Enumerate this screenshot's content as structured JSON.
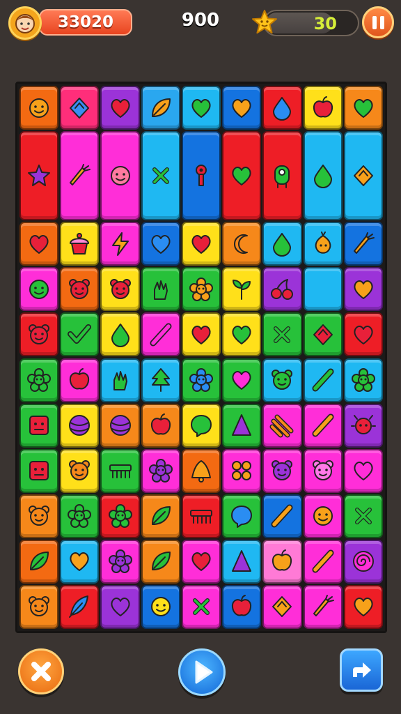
{
  "hud": {
    "coins": "33020",
    "score": "900",
    "stars": "30",
    "avatar_icon": "avatar-face-icon",
    "star_icon": "star-icon",
    "pause_icon": "pause-icon"
  },
  "board": {
    "rows": 12,
    "cols": 9,
    "tiles": [
      {
        "r": 0,
        "c": 0,
        "color": "#f36a12",
        "icon": "smiley",
        "ic": "#f7a11a"
      },
      {
        "r": 0,
        "c": 1,
        "color": "#ff2e7a",
        "icon": "diamond",
        "ic": "#3a8df2"
      },
      {
        "r": 0,
        "c": 2,
        "color": "#9b33d8",
        "icon": "heart",
        "ic": "#e8203a"
      },
      {
        "r": 0,
        "c": 3,
        "color": "#2aa7ef",
        "icon": "leaf",
        "ic": "#f7a11a"
      },
      {
        "r": 0,
        "c": 4,
        "color": "#1fb8f2",
        "icon": "heart",
        "ic": "#27c13a"
      },
      {
        "r": 0,
        "c": 5,
        "color": "#1473e0",
        "icon": "heart",
        "ic": "#f7a11a"
      },
      {
        "r": 0,
        "c": 6,
        "color": "#ee1e26",
        "icon": "drop",
        "ic": "#2a8df2"
      },
      {
        "r": 0,
        "c": 7,
        "color": "#ffe01a",
        "icon": "apple",
        "ic": "#e8203a"
      },
      {
        "r": 0,
        "c": 8,
        "color": "#f6881a",
        "icon": "heart",
        "ic": "#27c13a"
      },
      {
        "r": 1,
        "c": 0,
        "color": "#ee1e26",
        "h": 2,
        "icon": "star",
        "ic": "#9b33d8"
      },
      {
        "r": 1,
        "c": 1,
        "color": "#ff2ed8",
        "h": 2,
        "icon": "carrot",
        "ic": "#f7a11a"
      },
      {
        "r": 1,
        "c": 2,
        "color": "#ff2ed8",
        "h": 2,
        "icon": "smiley",
        "ic": "#ff7aa0"
      },
      {
        "r": 1,
        "c": 3,
        "color": "#1fb8f2",
        "h": 2,
        "icon": "cross",
        "ic": "#27c13a"
      },
      {
        "r": 1,
        "c": 4,
        "color": "#1473e0",
        "h": 2,
        "icon": "key",
        "ic": "#e8203a"
      },
      {
        "r": 1,
        "c": 5,
        "color": "#ee1e26",
        "h": 2,
        "icon": "heart",
        "ic": "#27c13a"
      },
      {
        "r": 1,
        "c": 6,
        "color": "#ee1e26",
        "h": 2,
        "icon": "robot",
        "ic": "#27c13a"
      },
      {
        "r": 1,
        "c": 7,
        "color": "#1fb8f2",
        "h": 2,
        "icon": "drop",
        "ic": "#27c13a"
      },
      {
        "r": 1,
        "c": 8,
        "color": "#1fb8f2",
        "h": 2,
        "icon": "diamond",
        "ic": "#f7a11a"
      },
      {
        "r": 3,
        "c": 0,
        "color": "#f36a12",
        "icon": "heart",
        "ic": "#e8203a"
      },
      {
        "r": 3,
        "c": 1,
        "color": "#ffe01a",
        "icon": "cupcake",
        "ic": "#e8203a"
      },
      {
        "r": 3,
        "c": 2,
        "color": "#ff2ed8",
        "icon": "bolt",
        "ic": "#f7a11a"
      },
      {
        "r": 3,
        "c": 3,
        "color": "#1473e0",
        "icon": "heart",
        "ic": "#2a8df2"
      },
      {
        "r": 3,
        "c": 4,
        "color": "#ffe01a",
        "icon": "heart",
        "ic": "#e8203a"
      },
      {
        "r": 3,
        "c": 5,
        "color": "#f6881a",
        "icon": "moon",
        "ic": "#f6881a"
      },
      {
        "r": 3,
        "c": 6,
        "color": "#1fb8f2",
        "icon": "drop",
        "ic": "#27c13a"
      },
      {
        "r": 3,
        "c": 7,
        "color": "#1fb8f2",
        "icon": "onion",
        "ic": "#f7a11a"
      },
      {
        "r": 3,
        "c": 8,
        "color": "#1473e0",
        "icon": "carrot",
        "ic": "#f7a11a"
      },
      {
        "r": 4,
        "c": 0,
        "color": "#ff2ed8",
        "icon": "smiley",
        "ic": "#27c13a"
      },
      {
        "r": 4,
        "c": 1,
        "color": "#f36a12",
        "icon": "bear",
        "ic": "#e8203a"
      },
      {
        "r": 4,
        "c": 2,
        "color": "#ffe01a",
        "icon": "bear",
        "ic": "#e8203a"
      },
      {
        "r": 4,
        "c": 3,
        "color": "#27c13a",
        "icon": "hand",
        "ic": "#27c13a"
      },
      {
        "r": 4,
        "c": 4,
        "color": "#27c13a",
        "icon": "flower",
        "ic": "#f7a11a"
      },
      {
        "r": 4,
        "c": 5,
        "color": "#ffe01a",
        "icon": "sprout",
        "ic": "#27c13a"
      },
      {
        "r": 4,
        "c": 6,
        "color": "#9b33d8",
        "icon": "cherry",
        "ic": "#e8203a"
      },
      {
        "r": 4,
        "c": 7,
        "color": "#1fb8f2",
        "icon": "none",
        "ic": "#1fb8f2"
      },
      {
        "r": 4,
        "c": 8,
        "color": "#9b33d8",
        "icon": "heart",
        "ic": "#f7a11a"
      },
      {
        "r": 5,
        "c": 0,
        "color": "#ee1e26",
        "icon": "bear",
        "ic": "#e8203a"
      },
      {
        "r": 5,
        "c": 1,
        "color": "#27c13a",
        "icon": "check",
        "ic": "#27c13a"
      },
      {
        "r": 5,
        "c": 2,
        "color": "#ffe01a",
        "icon": "drop",
        "ic": "#27c13a"
      },
      {
        "r": 5,
        "c": 3,
        "color": "#ff2ed8",
        "icon": "slash",
        "ic": "#ff2ed8"
      },
      {
        "r": 5,
        "c": 4,
        "color": "#ffe01a",
        "icon": "heart",
        "ic": "#e8203a"
      },
      {
        "r": 5,
        "c": 5,
        "color": "#ffe01a",
        "icon": "heart",
        "ic": "#27c13a"
      },
      {
        "r": 5,
        "c": 6,
        "color": "#27c13a",
        "icon": "cross",
        "ic": "#27c13a"
      },
      {
        "r": 5,
        "c": 7,
        "color": "#27c13a",
        "icon": "diamond",
        "ic": "#e8203a"
      },
      {
        "r": 5,
        "c": 8,
        "color": "#ee1e26",
        "icon": "heart",
        "ic": "#e8203a"
      },
      {
        "r": 6,
        "c": 0,
        "color": "#27c13a",
        "icon": "flower",
        "ic": "#27c13a"
      },
      {
        "r": 6,
        "c": 1,
        "color": "#ff2ed8",
        "icon": "apple",
        "ic": "#e8203a"
      },
      {
        "r": 6,
        "c": 2,
        "color": "#1fb8f2",
        "icon": "hand",
        "ic": "#27c13a"
      },
      {
        "r": 6,
        "c": 3,
        "color": "#1fb8f2",
        "icon": "tree",
        "ic": "#27c13a"
      },
      {
        "r": 6,
        "c": 4,
        "color": "#27c13a",
        "icon": "flower",
        "ic": "#2a8df2"
      },
      {
        "r": 6,
        "c": 5,
        "color": "#27c13a",
        "icon": "heart",
        "ic": "#ff2ed8"
      },
      {
        "r": 6,
        "c": 6,
        "color": "#1fb8f2",
        "icon": "bear",
        "ic": "#27c13a"
      },
      {
        "r": 6,
        "c": 7,
        "color": "#1fb8f2",
        "icon": "slash",
        "ic": "#27c13a"
      },
      {
        "r": 6,
        "c": 8,
        "color": "#1fb8f2",
        "icon": "flower",
        "ic": "#27c13a"
      },
      {
        "r": 7,
        "c": 0,
        "color": "#27c13a",
        "icon": "box",
        "ic": "#e8203a"
      },
      {
        "r": 7,
        "c": 1,
        "color": "#ffe01a",
        "icon": "ball",
        "ic": "#9b33d8"
      },
      {
        "r": 7,
        "c": 2,
        "color": "#f6881a",
        "icon": "ball",
        "ic": "#9b33d8"
      },
      {
        "r": 7,
        "c": 3,
        "color": "#f6881a",
        "icon": "apple",
        "ic": "#e8203a"
      },
      {
        "r": 7,
        "c": 4,
        "color": "#ffe01a",
        "icon": "bubble",
        "ic": "#27c13a"
      },
      {
        "r": 7,
        "c": 5,
        "color": "#27c13a",
        "icon": "cone",
        "ic": "#9b33d8"
      },
      {
        "r": 7,
        "c": 6,
        "color": "#ff2ed8",
        "icon": "stripes",
        "ic": "#f6881a"
      },
      {
        "r": 7,
        "c": 7,
        "color": "#ff2ed8",
        "icon": "slash",
        "ic": "#f7a11a"
      },
      {
        "r": 7,
        "c": 8,
        "color": "#9b33d8",
        "icon": "bug",
        "ic": "#e8203a"
      },
      {
        "r": 8,
        "c": 0,
        "color": "#27c13a",
        "icon": "box",
        "ic": "#e8203a"
      },
      {
        "r": 8,
        "c": 1,
        "color": "#ffe01a",
        "icon": "bear",
        "ic": "#f6881a"
      },
      {
        "r": 8,
        "c": 2,
        "color": "#27c13a",
        "icon": "comb",
        "ic": "#27c13a"
      },
      {
        "r": 8,
        "c": 3,
        "color": "#ff2ed8",
        "icon": "flower",
        "ic": "#9b33d8"
      },
      {
        "r": 8,
        "c": 4,
        "color": "#f36a12",
        "icon": "bell",
        "ic": "#f7a11a"
      },
      {
        "r": 8,
        "c": 5,
        "color": "#ff2ed8",
        "icon": "dots",
        "ic": "#f7a11a"
      },
      {
        "r": 8,
        "c": 6,
        "color": "#ff2ed8",
        "icon": "bear",
        "ic": "#9b33d8"
      },
      {
        "r": 8,
        "c": 7,
        "color": "#ff2ed8",
        "icon": "bear",
        "ic": "#ff7ae8"
      },
      {
        "r": 8,
        "c": 8,
        "color": "#ff2ed8",
        "icon": "heart",
        "ic": "#ff2ed8"
      },
      {
        "r": 9,
        "c": 0,
        "color": "#f6881a",
        "icon": "bear",
        "ic": "#f6881a"
      },
      {
        "r": 9,
        "c": 1,
        "color": "#27c13a",
        "icon": "flower",
        "ic": "#27c13a"
      },
      {
        "r": 9,
        "c": 2,
        "color": "#ee1e26",
        "icon": "flower",
        "ic": "#27c13a"
      },
      {
        "r": 9,
        "c": 3,
        "color": "#f6881a",
        "icon": "leaf",
        "ic": "#27c13a"
      },
      {
        "r": 9,
        "c": 4,
        "color": "#ee1e26",
        "icon": "comb",
        "ic": "#ee1e26"
      },
      {
        "r": 9,
        "c": 5,
        "color": "#27c13a",
        "icon": "bubble",
        "ic": "#2a8df2"
      },
      {
        "r": 9,
        "c": 6,
        "color": "#1473e0",
        "icon": "slash",
        "ic": "#f7a11a"
      },
      {
        "r": 9,
        "c": 7,
        "color": "#ff2ed8",
        "icon": "smiley",
        "ic": "#f7a11a"
      },
      {
        "r": 9,
        "c": 8,
        "color": "#27c13a",
        "icon": "cross",
        "ic": "#27c13a"
      },
      {
        "r": 10,
        "c": 0,
        "color": "#f36a12",
        "icon": "leaf",
        "ic": "#27c13a"
      },
      {
        "r": 10,
        "c": 1,
        "color": "#1fb8f2",
        "icon": "heart",
        "ic": "#f7a11a"
      },
      {
        "r": 10,
        "c": 2,
        "color": "#ff2ed8",
        "icon": "flower",
        "ic": "#9b33d8"
      },
      {
        "r": 10,
        "c": 3,
        "color": "#f6881a",
        "icon": "leaf",
        "ic": "#27c13a"
      },
      {
        "r": 10,
        "c": 4,
        "color": "#ff2ed8",
        "icon": "heart",
        "ic": "#e8203a"
      },
      {
        "r": 10,
        "c": 5,
        "color": "#1fb8f2",
        "icon": "cone",
        "ic": "#9b33d8"
      },
      {
        "r": 10,
        "c": 6,
        "color": "#ff7ad6",
        "icon": "apple",
        "ic": "#f7a11a"
      },
      {
        "r": 10,
        "c": 7,
        "color": "#ff2ed8",
        "icon": "slash",
        "ic": "#f7a11a"
      },
      {
        "r": 10,
        "c": 8,
        "color": "#9b33d8",
        "icon": "swirl",
        "ic": "#ff2ed8"
      },
      {
        "r": 11,
        "c": 0,
        "color": "#f6881a",
        "icon": "bear",
        "ic": "#f6881a"
      },
      {
        "r": 11,
        "c": 1,
        "color": "#ee1e26",
        "icon": "feather",
        "ic": "#2a8df2"
      },
      {
        "r": 11,
        "c": 2,
        "color": "#9b33d8",
        "icon": "heart",
        "ic": "#9b33d8"
      },
      {
        "r": 11,
        "c": 3,
        "color": "#1473e0",
        "icon": "smiley",
        "ic": "#ffe01a"
      },
      {
        "r": 11,
        "c": 4,
        "color": "#ff2ed8",
        "icon": "cross",
        "ic": "#27c13a"
      },
      {
        "r": 11,
        "c": 5,
        "color": "#1473e0",
        "icon": "apple",
        "ic": "#e8203a"
      },
      {
        "r": 11,
        "c": 6,
        "color": "#ff2ed8",
        "icon": "diamond",
        "ic": "#f7a11a"
      },
      {
        "r": 11,
        "c": 7,
        "color": "#ff2ed8",
        "icon": "carrot",
        "ic": "#f7a11a"
      },
      {
        "r": 11,
        "c": 8,
        "color": "#ee1e26",
        "icon": "heart",
        "ic": "#f7a11a"
      }
    ]
  },
  "controls": {
    "close_icon": "close-icon",
    "play_icon": "play-icon",
    "share_icon": "share-arrow-icon"
  }
}
